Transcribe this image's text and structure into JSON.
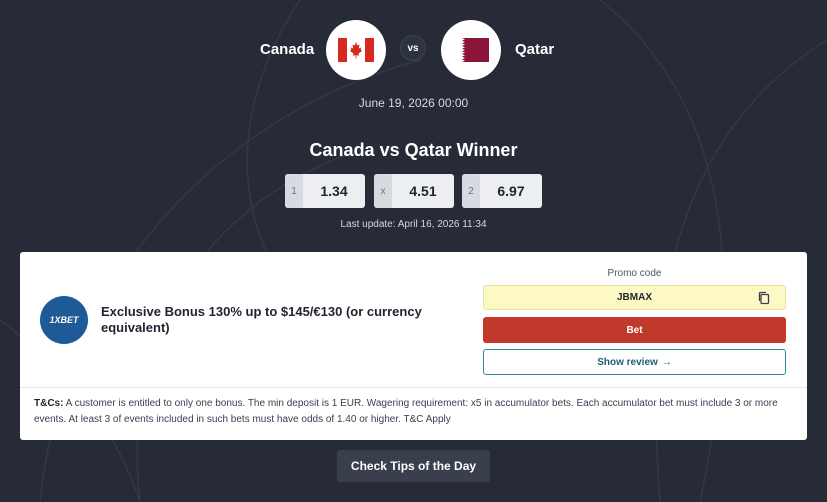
{
  "match": {
    "home_team": "Canada",
    "away_team": "Qatar",
    "vs_label": "vs",
    "date": "June 19, 2026 00:00",
    "home_flag_icon": "canada-flag-icon",
    "away_flag_icon": "qatar-flag-icon"
  },
  "market": {
    "title": "Canada vs Qatar Winner",
    "odds": [
      {
        "label": "1",
        "value": "1.34"
      },
      {
        "label": "x",
        "value": "4.51"
      },
      {
        "label": "2",
        "value": "6.97"
      }
    ],
    "last_update": "Last update: April 16, 2026 11:34"
  },
  "offer": {
    "bookmaker_logo_text": "1XBET",
    "bonus_title": "Exclusive Bonus 130% up to $145/€130 (or currency equivalent)",
    "promo_label": "Promo code",
    "promo_code": "JBMAX",
    "copy_icon": "copy-icon",
    "bet_label": "Bet",
    "review_label": "Show review",
    "review_arrow": "→",
    "terms_label": "T&Cs:",
    "terms_text": " A customer is entitled to only one bonus. The min deposit is 1 EUR. Wagering requirement: x5 in accumulator bets. Each accumulator bet must include 3 or more events. At least 3 of events included in such bets must have odds of 1.40 or higher. T&C Apply"
  },
  "footer": {
    "tips_button_label": "Check Tips of the Day"
  },
  "colors": {
    "background": "#262b37",
    "bet_button": "#c0392b",
    "promo_field": "#fdf9c4",
    "review_border": "#2a8b96",
    "bookmaker_brand": "#1d5a96"
  }
}
